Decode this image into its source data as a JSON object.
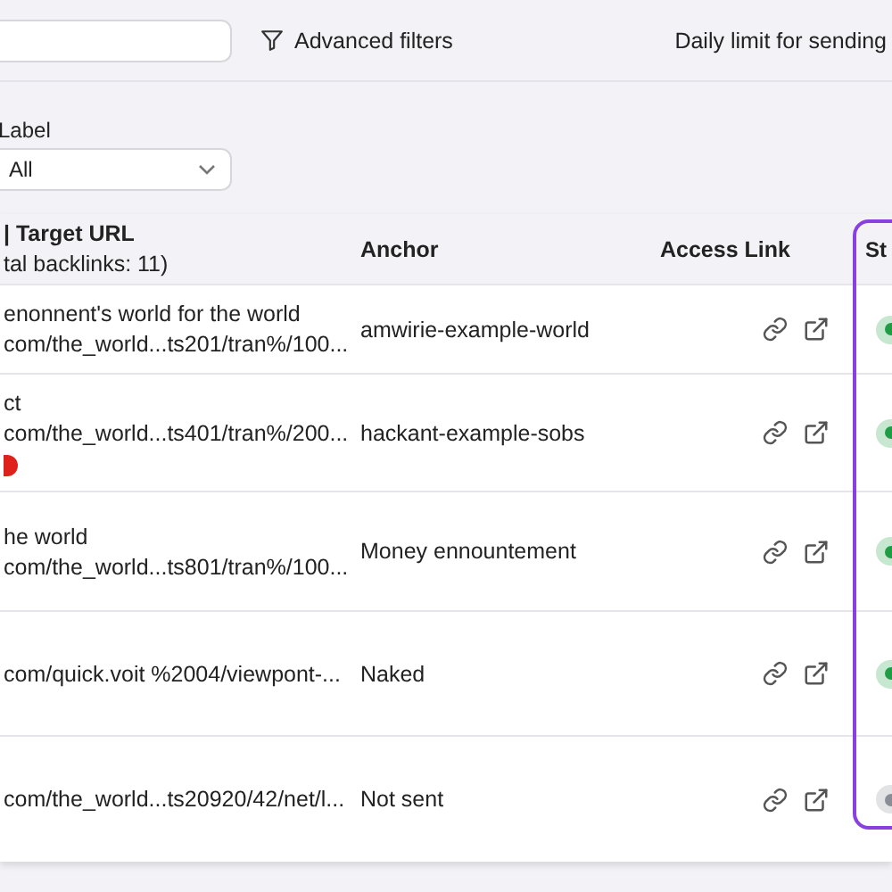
{
  "toolbar": {
    "advanced_filters": "Advanced filters",
    "daily_limit": "Daily limit for sending"
  },
  "filters": {
    "label_filter": {
      "label": "Label",
      "value": "All"
    }
  },
  "table": {
    "columns": [
      {
        "title": "| Target URL",
        "subtitle": "tal backlinks: 11)"
      },
      {
        "title": "Anchor"
      },
      {
        "title": "Access Link"
      },
      {
        "title": "St"
      }
    ],
    "rows": [
      {
        "source_title": "enonnent's world for the world",
        "target_url": "com/the_world...ts201/tran%/100...",
        "anchor": "amwirie-example-world",
        "warning": false,
        "color": "#1f9d45"
      },
      {
        "source_title": "ct",
        "target_url": "com/the_world...ts401/tran%/200...",
        "anchor": "hackant-example-sobs",
        "warning": true,
        "color": "#1f9d45"
      },
      {
        "source_title": "he world",
        "target_url": "com/the_world...ts801/tran%/100...",
        "anchor": "Money ennountement",
        "warning": false,
        "color": "#1f9d45"
      },
      {
        "target_url": "com/quick.voit %2004/viewpont-...",
        "anchor": "Naked",
        "warning": false,
        "color": "#1f9d45"
      },
      {
        "target_url": "com/the_world...ts20920/42/net/l...",
        "anchor": "Not sent",
        "warning": false,
        "color": "#8a8d96"
      }
    ]
  }
}
